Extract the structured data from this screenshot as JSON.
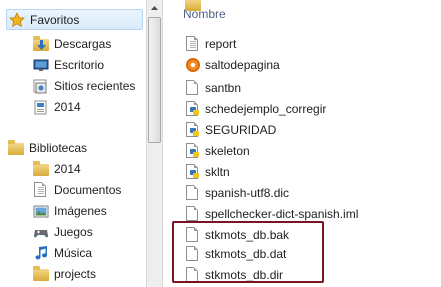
{
  "navigation": {
    "favorites": {
      "label": "Favoritos",
      "items": [
        {
          "label": "Descargas",
          "icon": "downloads-folder-icon"
        },
        {
          "label": "Escritorio",
          "icon": "desktop-icon"
        },
        {
          "label": "Sitios recientes",
          "icon": "recent-places-icon"
        },
        {
          "label": "2014",
          "icon": "folder-icon"
        }
      ]
    },
    "libraries": {
      "label": "Bibliotecas",
      "items": [
        {
          "label": "2014",
          "icon": "library-folder-icon"
        },
        {
          "label": "Documentos",
          "icon": "documents-library-icon"
        },
        {
          "label": "Imágenes",
          "icon": "pictures-library-icon"
        },
        {
          "label": "Juegos",
          "icon": "games-icon"
        },
        {
          "label": "Música",
          "icon": "music-library-icon"
        },
        {
          "label": "projects",
          "icon": "library-folder-icon"
        }
      ]
    }
  },
  "file_list": {
    "column_name": "Nombre",
    "files": [
      {
        "name": "report",
        "icon": "text-file-icon"
      },
      {
        "name": "saltodepagina",
        "icon": "gear-file-icon"
      },
      {
        "name": "santbn",
        "icon": "file-icon"
      },
      {
        "name": "schedejemplo_corregir",
        "icon": "python-file-icon"
      },
      {
        "name": "SEGURIDAD",
        "icon": "python-file-icon"
      },
      {
        "name": "skeleton",
        "icon": "python-file-icon"
      },
      {
        "name": "skltn",
        "icon": "python-file-icon"
      },
      {
        "name": "spanish-utf8.dic",
        "icon": "file-icon"
      },
      {
        "name": "spellchecker-dict-spanish.iml",
        "icon": "file-icon"
      },
      {
        "name": "stkmots_db.bak",
        "icon": "file-icon"
      },
      {
        "name": "stkmots_db.dat",
        "icon": "file-icon"
      },
      {
        "name": "stkmots_db.dir",
        "icon": "file-icon"
      }
    ]
  },
  "colors": {
    "highlight_border": "#7a1420",
    "header_text": "#4d6185",
    "selection_bg": "#d9ebf9"
  }
}
